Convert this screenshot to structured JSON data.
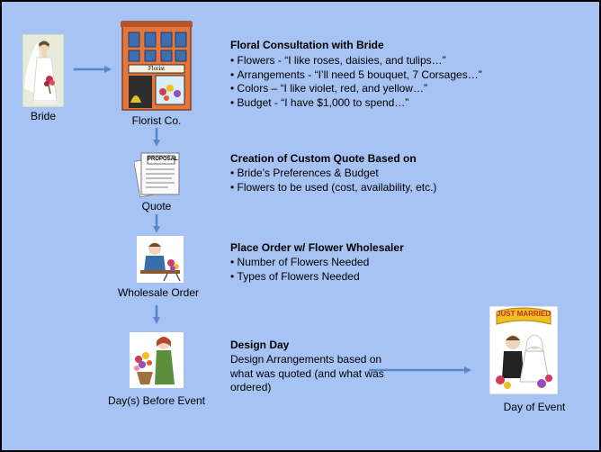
{
  "nodes": {
    "bride": "Bride",
    "florist": "Florist Co.",
    "florist_sign": "Florist",
    "quote": "Quote",
    "proposal_sheet": "PROPOSAL",
    "wholesale": "Wholesale Order",
    "days_before": "Day(s) Before Event",
    "day_of_event": "Day of Event",
    "banner": "JUST MARRIED"
  },
  "sections": {
    "consultation": {
      "title": "Floral Consultation with Bride",
      "items": [
        "Flowers - “I like roses, daisies, and tulips…”",
        "Arrangements - “I’ll need 5 bouquet, 7 Corsages…”",
        "Colors – “I like violet, red, and yellow…”",
        "Budget - “I have $1,000 to spend…”"
      ]
    },
    "quote": {
      "title": "Creation of Custom Quote Based on",
      "items": [
        "Bride’s Preferences & Budget",
        "Flowers to be used (cost, availability, etc.)"
      ]
    },
    "order": {
      "title": "Place Order w/ Flower Wholesaler",
      "items": [
        "Number of Flowers Needed",
        "Types of Flowers Needed"
      ]
    },
    "design": {
      "title": "Design Day",
      "lines": [
        "Design Arrangements based on",
        "what was quoted (and what was",
        "ordered)"
      ]
    }
  },
  "colors": {
    "background": "#a6c3f4",
    "frame": "#000000",
    "arrow": "#5b86c9"
  }
}
